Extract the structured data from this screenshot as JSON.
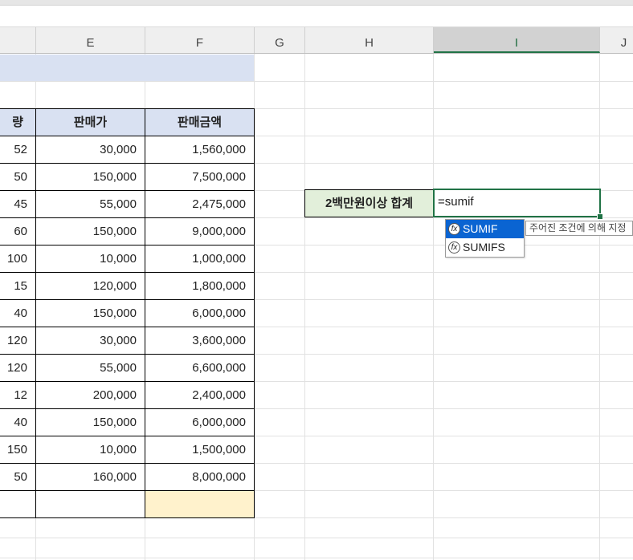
{
  "columns": [
    "E",
    "F",
    "G",
    "H",
    "I",
    "J"
  ],
  "table": {
    "headers": [
      "량",
      "판매가",
      "판매금액"
    ],
    "rows": [
      [
        "52",
        "30,000",
        "1,560,000"
      ],
      [
        "50",
        "150,000",
        "7,500,000"
      ],
      [
        "45",
        "55,000",
        "2,475,000"
      ],
      [
        "60",
        "150,000",
        "9,000,000"
      ],
      [
        "100",
        "10,000",
        "1,000,000"
      ],
      [
        "15",
        "120,000",
        "1,800,000"
      ],
      [
        "40",
        "150,000",
        "6,000,000"
      ],
      [
        "120",
        "30,000",
        "3,600,000"
      ],
      [
        "120",
        "55,000",
        "6,600,000"
      ],
      [
        "12",
        "200,000",
        "2,400,000"
      ],
      [
        "40",
        "150,000",
        "6,000,000"
      ],
      [
        "150",
        "10,000",
        "1,500,000"
      ],
      [
        "50",
        "160,000",
        "8,000,000"
      ]
    ]
  },
  "summary": {
    "label": "2백만원이상 합계",
    "formula": "=sumif"
  },
  "autocomplete": {
    "items": [
      "SUMIF",
      "SUMIFS"
    ],
    "icon_text": "fx",
    "tooltip": "주어진 조건에 의해 지정"
  },
  "colors": {
    "header_fill": "#d9e1f2",
    "label_fill": "#e2efda",
    "highlight_fill": "#fff2cc",
    "accent_green": "#217346",
    "selection_blue": "#0a64d2"
  }
}
